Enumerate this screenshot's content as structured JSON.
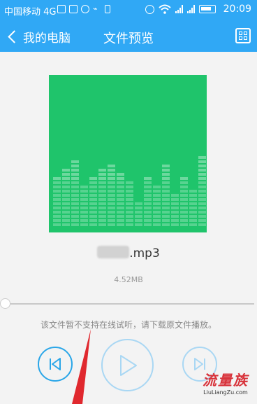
{
  "status_bar": {
    "carrier": "中国移动 4G",
    "time": "20:09",
    "icons": [
      "image-icon",
      "keyboard-icon",
      "shield-icon",
      "usb-icon",
      "battery-saver-icon",
      "alarm-icon",
      "wifi-icon",
      "signal-icon",
      "battery-icon"
    ]
  },
  "header": {
    "back_label": "我的电脑",
    "title": "文件预览",
    "qr_icon": "qr-code-icon"
  },
  "file": {
    "name_suffix": ".mp3",
    "size": "4.52MB"
  },
  "player": {
    "progress": 0,
    "notice": "该文件暂不支持在线试听，请下载原文件播放。",
    "controls": [
      "previous-icon",
      "play-icon",
      "next-icon"
    ]
  },
  "watermark": {
    "url": "LiuLiangZu.com"
  },
  "colors": {
    "header": "#30a8f5",
    "album": "#1fc46b",
    "accent": "#2aa6e8",
    "background": "#f3f3f3"
  }
}
